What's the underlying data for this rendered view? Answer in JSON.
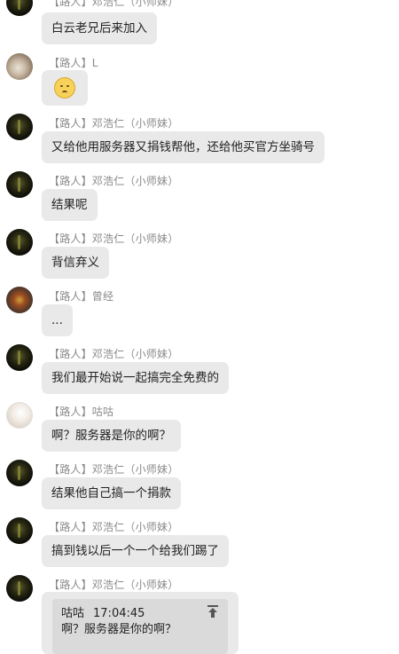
{
  "messages": [
    {
      "sender": "【路人】邓浩仁（小师妹）",
      "text": "白云老兄后来加入"
    },
    {
      "sender": "【路人】L",
      "emoji": "sad-face-emoji"
    },
    {
      "sender": "【路人】邓浩仁（小师妹）",
      "text": "又给他用服务器又捐钱帮他，还给他买官方坐骑号"
    },
    {
      "sender": "【路人】邓浩仁（小师妹）",
      "text": "结果呢"
    },
    {
      "sender": "【路人】邓浩仁（小师妹）",
      "text": "背信弃义"
    },
    {
      "sender": "【路人】曾经",
      "text": "..."
    },
    {
      "sender": "【路人】邓浩仁（小师妹）",
      "text": "我们最开始说一起搞完全免费的"
    },
    {
      "sender": "【路人】咕咕",
      "text": "啊？服务器是你的啊？"
    },
    {
      "sender": "【路人】邓浩仁（小师妹）",
      "text": "结果他自己搞一个捐款"
    },
    {
      "sender": "【路人】邓浩仁（小师妹）",
      "text": "搞到钱以后一个一个给我们踢了"
    },
    {
      "sender": "【路人】邓浩仁（小师妹）",
      "quote": {
        "author": "咕咕",
        "time": "17:04:45",
        "text": "啊？服务器是你的啊？"
      }
    }
  ],
  "colors": {
    "bubble": "#e9e9e9",
    "quote_box": "#dadada",
    "sender_name": "#8a8a8a"
  }
}
